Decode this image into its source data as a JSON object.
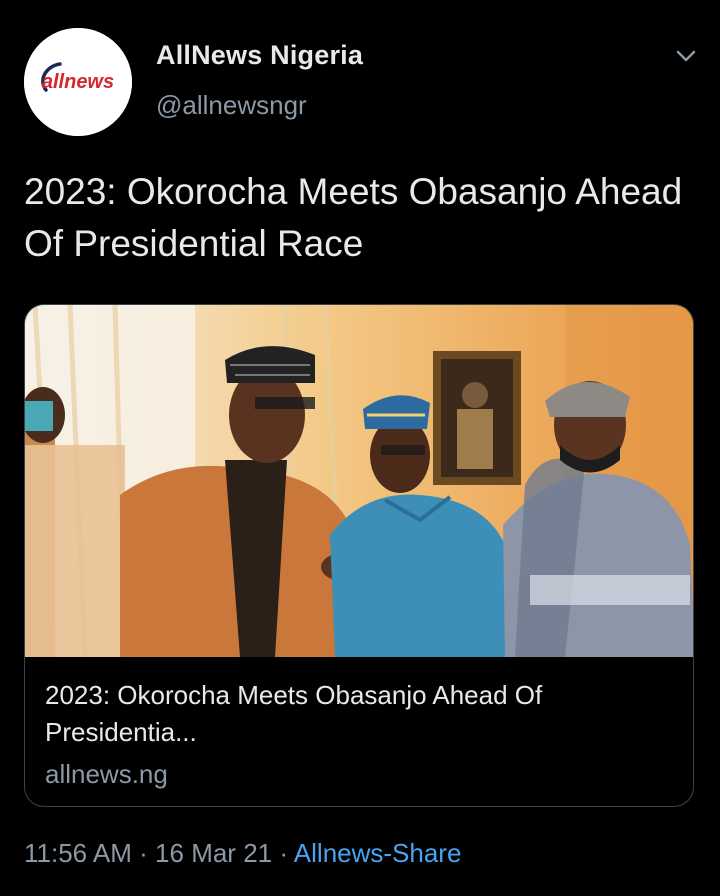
{
  "account": {
    "display_name": "AllNews Nigeria",
    "handle": "@allnewsngr",
    "avatar_logo_text": "allnews",
    "brand_color": "#d7262d"
  },
  "tweet": {
    "text": "2023: Okorocha Meets Obasanjo Ahead Of Presidential Race"
  },
  "card": {
    "image_icon": "photo-image",
    "title": "2023: Okorocha Meets Obasanjo Ahead Of Presidentia...",
    "domain": "allnews.ng"
  },
  "meta": {
    "time": "11:56 AM",
    "separator": " · ",
    "date": "16 Mar 21",
    "source": "Allnews-Share"
  },
  "colors": {
    "background": "#000000",
    "primary_text": "#e7e9ea",
    "secondary_text": "#8b98a5",
    "link": "#4aa3f0",
    "card_border": "#38444d"
  }
}
